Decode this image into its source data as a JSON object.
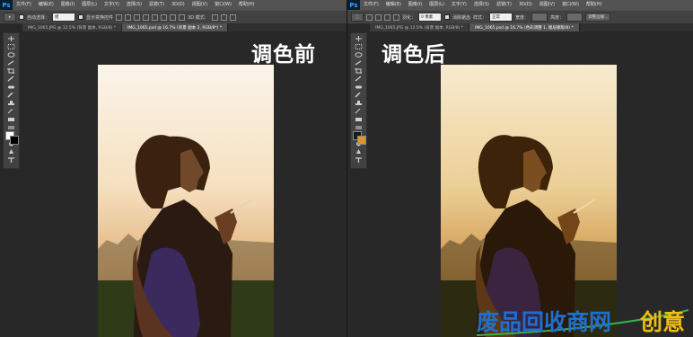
{
  "app": {
    "logo": "Ps"
  },
  "menu": [
    "文件(F)",
    "编辑(E)",
    "图像(I)",
    "图层(L)",
    "文字(Y)",
    "选择(S)",
    "滤镜(T)",
    "3D(D)",
    "视图(V)",
    "窗口(W)",
    "帮助(H)"
  ],
  "left": {
    "options": {
      "auto_select_label": "自动选择：",
      "auto_select_value": "组",
      "transform_label": "显示变换控件",
      "mode_3d": "3D 模式："
    },
    "tabs": [
      {
        "label": "IMG_1065.JPG @ 12.5% (背景 副本, RGB/8) *",
        "active": false
      },
      {
        "label": "IMG_1065.psd @ 16.7% (背景 副本 2, RGB/8*) *",
        "active": true
      }
    ],
    "caption": "调色前"
  },
  "right": {
    "options": {
      "feather_label": "羽化：",
      "feather_value": "0 像素",
      "antialias_label": "消除锯齿",
      "style_label": "样式：",
      "style_value": "正常",
      "width_label": "宽度：",
      "height_label": "高度：",
      "refine_label": "调整边缘..."
    },
    "tabs": [
      {
        "label": "IMG_1065.JPG @ 12.5% (背景 副本, RGB/8) *",
        "active": false
      },
      {
        "label": "IMG_1065.psd @ 16.7% (色彩调整 1, 图层蒙版/8) *",
        "active": true
      }
    ],
    "caption": "调色后"
  },
  "watermark": {
    "text": "废品回收商网",
    "logo_text": "创意"
  },
  "colors": {
    "accent_ps": "#31a8ff",
    "watermark_blue": "#1f6fd1",
    "watermark_yellow": "#f0bd10"
  }
}
